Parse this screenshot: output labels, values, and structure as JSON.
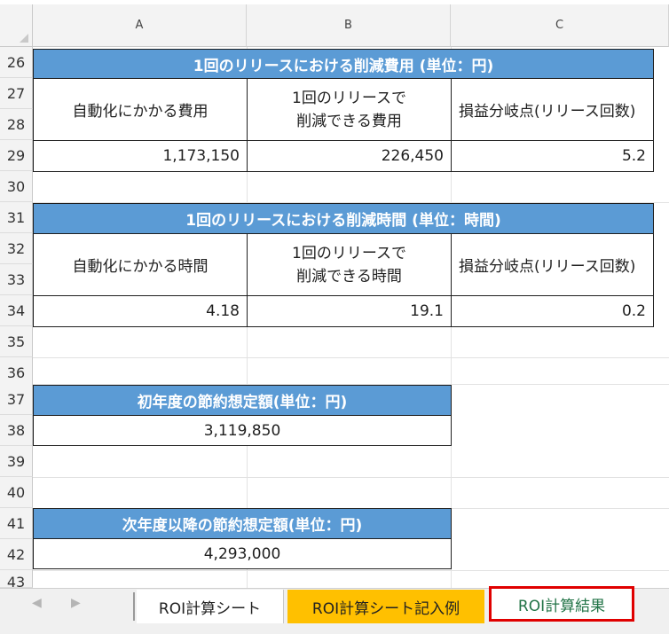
{
  "columns": [
    "A",
    "B",
    "C"
  ],
  "rows": [
    "26",
    "27",
    "28",
    "29",
    "30",
    "31",
    "32",
    "33",
    "34",
    "35",
    "36",
    "37",
    "38",
    "39",
    "40",
    "41",
    "42",
    "43"
  ],
  "cost_section": {
    "title": "1回のリリースにおける削減費用 (単位：円)",
    "col1_header": "自動化にかかる費用",
    "col2_header_line1": "1回のリリースで",
    "col2_header_line2": "削減できる費用",
    "col3_header": "損益分岐点(リリース回数)",
    "col1_value": "1,173,150",
    "col2_value": "226,450",
    "col3_value": "5.2"
  },
  "time_section": {
    "title": "1回のリリースにおける削減時間 (単位：時間)",
    "col1_header": "自動化にかかる時間",
    "col2_header_line1": "1回のリリースで",
    "col2_header_line2": "削減できる時間",
    "col3_header": "損益分岐点(リリース回数)",
    "col1_value": "4.18",
    "col2_value": "19.1",
    "col3_value": "0.2"
  },
  "first_year": {
    "title": "初年度の節約想定額(単位：円)",
    "value": "3,119,850"
  },
  "next_year": {
    "title": "次年度以降の節約想定額(単位：円)",
    "value": "4,293,000"
  },
  "sheet_tabs": {
    "prev": "◀",
    "next": "▶",
    "tab1": "ROI計算シート",
    "tab2": "ROI計算シート記入例",
    "tab3": "ROI計算結果",
    "tab2_color": "#ffc000",
    "active_color": "#217346",
    "highlight_color": "#e00000"
  }
}
